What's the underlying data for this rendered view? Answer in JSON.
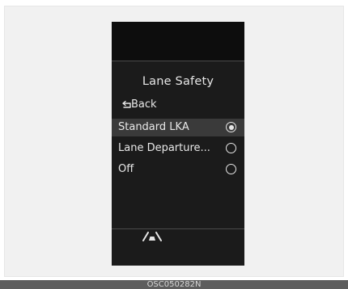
{
  "menu": {
    "title": "Lane Safety",
    "back_label": "Back",
    "options": [
      {
        "label": "Standard LKA",
        "selected": true
      },
      {
        "label": "Lane Departure...",
        "selected": false
      },
      {
        "label": "Off",
        "selected": false
      }
    ]
  },
  "footer": {
    "icon": "lane-assist-icon"
  },
  "caption": "OSC050282N",
  "colors": {
    "screen_bg": "#1b1b1b",
    "text": "#e8e8e8",
    "selected_row": "#3a3a3a"
  }
}
